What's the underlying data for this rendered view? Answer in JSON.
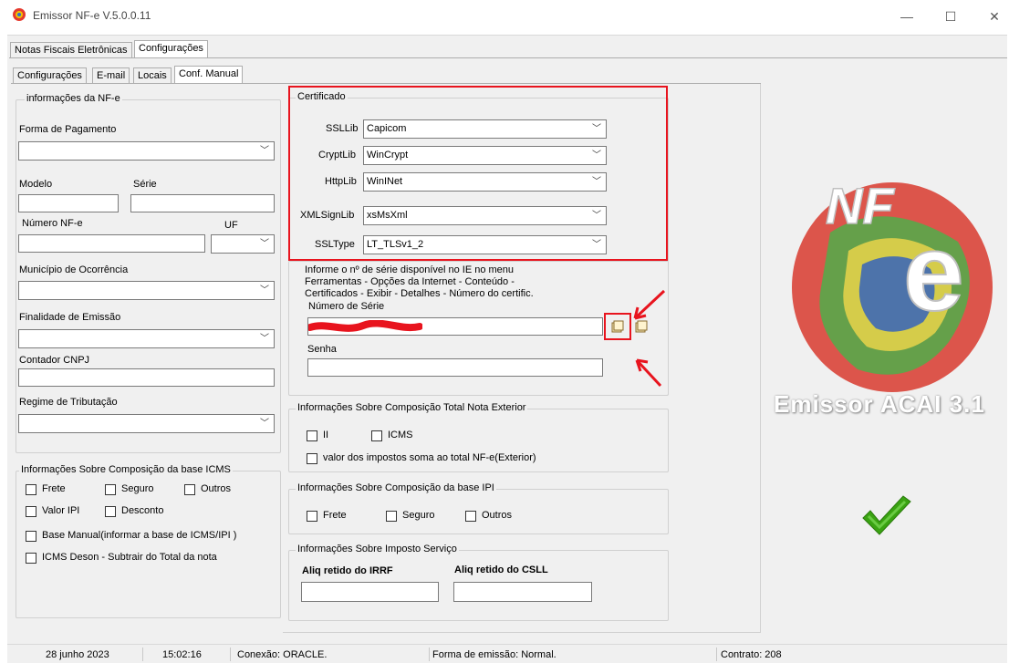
{
  "window": {
    "title": "Emissor NF-e V.5.0.0.11",
    "minimize": "—",
    "maximize": "☐",
    "close": "✕"
  },
  "main_tabs": [
    "Notas Fiscais Eletrônicas",
    "Configurações"
  ],
  "sub_tabs": [
    "Configurações",
    "E-mail",
    "Locais",
    "Conf. Manual"
  ],
  "nfe_group": {
    "legend": "informações da NF-e",
    "forma_pagamento": "Forma de Pagamento",
    "modelo": "Modelo",
    "serie": "Série",
    "numero": "Número NF-e",
    "uf": "UF",
    "municipio": "Município de Ocorrência",
    "finalidade": "Finalidade de Emissão",
    "contador": "Contador CNPJ",
    "regime": "Regime de Tributação"
  },
  "icms_group": {
    "legend": "Informações Sobre Composição  da base ICMS",
    "frete": "Frete",
    "seguro": "Seguro",
    "outros": "Outros",
    "valor_ipi": "Valor IPI",
    "desconto": "Desconto",
    "base_manual": "Base Manual(informar a base de ICMS/IPI )",
    "icms_deson": "ICMS Deson - Subtrair do Total da nota"
  },
  "cert_group": {
    "legend": "Certificado",
    "ssllib_label": "SSLLib",
    "ssllib_value": "Capicom",
    "cryptlib_label": "CryptLib",
    "cryptlib_value": "WinCrypt",
    "httplib_label": "HttpLib",
    "httplib_value": "WinINet",
    "xmlsign_label": "XMLSignLib",
    "xmlsign_value": "xsMsXml",
    "ssltype_label": "SSLType",
    "ssltype_value": "LT_TLSv1_2"
  },
  "serial": {
    "info1": "Informe o nº de série disponível no IE no menu",
    "info2": "Ferramentas - Opções da Internet - Conteúdo -",
    "info3": "Certificados - Exibir - Detalhes - Número do certific.",
    "numero_label": "Número de Série",
    "senha_label": "Senha"
  },
  "exterior_group": {
    "legend": "Informações Sobre Composição  Total Nota Exterior",
    "ii": "II",
    "icms": "ICMS",
    "soma": "valor dos impostos soma ao total NF-e(Exterior)"
  },
  "ipi_group": {
    "legend": "Informações Sobre Composição  da base IPI",
    "frete": "Frete",
    "seguro": "Seguro",
    "outros": "Outros"
  },
  "servico_group": {
    "legend": "Informações Sobre Imposto Serviço",
    "irrf": "Aliq retido do IRRF",
    "csll": "Aliq retido do CSLL"
  },
  "logo": {
    "banner": "Emissor ACAI 3.1",
    "letters": "NF e"
  },
  "status_bar": {
    "date": "28 junho 2023",
    "time": "15:02:16",
    "conexao": "Conexão: ORACLE.",
    "forma": "Forma de emissão: Normal.",
    "contrato": "Contrato: 208"
  },
  "colors": {
    "highlight": "#e8141e",
    "check": "#3aa312"
  }
}
